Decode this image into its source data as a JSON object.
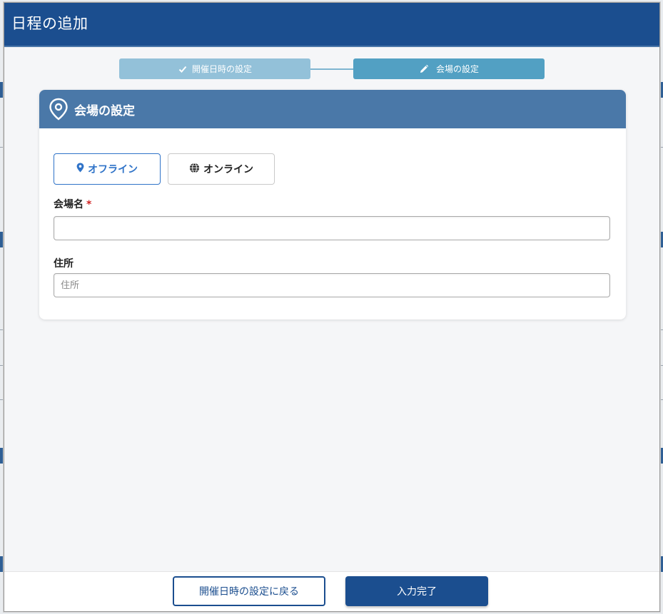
{
  "modal": {
    "title": "日程の追加"
  },
  "stepper": {
    "steps": [
      {
        "label": "開催日時の設定",
        "state": "completed",
        "icon": "check-icon"
      },
      {
        "label": "会場の設定",
        "state": "active",
        "icon": "pencil-icon"
      }
    ]
  },
  "card": {
    "title": "会場の設定",
    "icon": "location-pin-icon",
    "venue_type_options": [
      {
        "label": "オフライン",
        "icon": "map-marker-icon",
        "selected": true
      },
      {
        "label": "オンライン",
        "icon": "globe-icon",
        "selected": false
      }
    ],
    "fields": {
      "venue_name": {
        "label": "会場名",
        "required_mark": "*",
        "value": "",
        "placeholder": ""
      },
      "address": {
        "label": "住所",
        "value": "",
        "placeholder": "住所"
      }
    }
  },
  "footer": {
    "back_label": "開催日時の設定に戻る",
    "complete_label": "入力完了"
  },
  "colors": {
    "header": "#1b4e8f",
    "step_completed": "#93c1d9",
    "step_active": "#52a0c3",
    "card_header": "#4a78a8",
    "accent": "#2f73c8",
    "required": "#d02424"
  }
}
